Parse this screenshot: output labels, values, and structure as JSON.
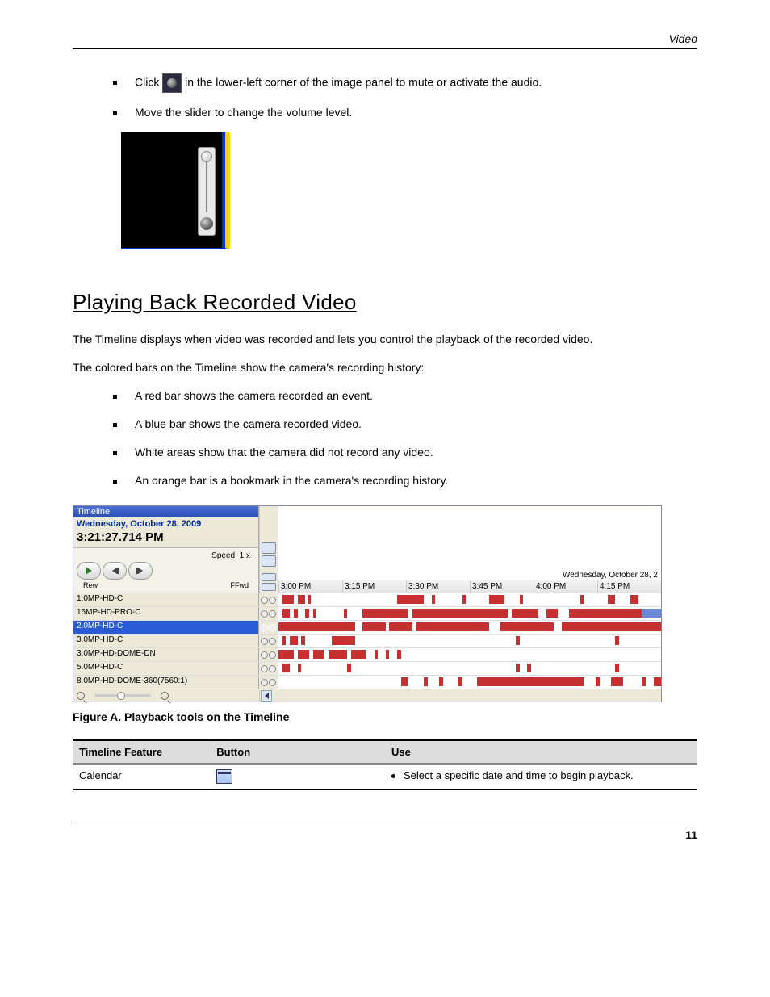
{
  "header": {
    "section": "Video"
  },
  "bullets_top": [
    {
      "text_before": "Click ",
      "icon": "volume-icon",
      "text_after": " in the lower-left corner of the image panel to mute or activate the audio."
    },
    {
      "text_before": "Move the slider to change the volume level.",
      "icon": null,
      "text_after": ""
    }
  ],
  "section_title": "Playing Back Recorded Video",
  "intro": "The Timeline displays when video was recorded and lets you control the playback of the recorded video.",
  "sub_intro": "The colored bars on the Timeline show the camera's recording history:",
  "legend": [
    "A red bar shows the camera recorded an event.",
    "A blue bar shows the camera recorded video.",
    "White areas show that the camera did not record any video.",
    "An orange bar is a bookmark in the camera's recording history."
  ],
  "timeline": {
    "title": "Timeline",
    "date": "Wednesday, October 28, 2009",
    "time": "3:21:27.714 PM",
    "speed": "Speed: 1 x",
    "rew": "Rew",
    "ffwd": "FFwd",
    "ruler_date": "Wednesday, October 28, 2",
    "ticks": [
      "3:00 PM",
      "3:15 PM",
      "3:30 PM",
      "3:45 PM",
      "4:00 PM",
      "4:15 PM"
    ],
    "rows": [
      {
        "label": "1.0MP-HD-C",
        "selected": false,
        "segs": [
          [
            1,
            4
          ],
          [
            5,
            7
          ],
          [
            7.5,
            8.5
          ],
          [
            31,
            38
          ],
          [
            40,
            41
          ],
          [
            48,
            49
          ],
          [
            55,
            59
          ],
          [
            63,
            64
          ],
          [
            79,
            80
          ],
          [
            86,
            88
          ],
          [
            92,
            94
          ]
        ]
      },
      {
        "label": "16MP-HD-PRO-C",
        "selected": false,
        "segs": [
          [
            1,
            3
          ],
          [
            4,
            5
          ],
          [
            7,
            8
          ],
          [
            9,
            10
          ],
          [
            17,
            18
          ],
          [
            22,
            30
          ],
          [
            30,
            34
          ],
          [
            35,
            55
          ],
          [
            55,
            60
          ],
          [
            61,
            68
          ],
          [
            70,
            73
          ],
          [
            76,
            95
          ],
          [
            95,
            100,
            "blue"
          ]
        ]
      },
      {
        "label": "2.0MP-HD-C",
        "selected": true,
        "segs": [
          [
            0,
            20
          ],
          [
            22,
            28
          ],
          [
            29,
            35
          ],
          [
            36,
            55
          ],
          [
            58,
            72
          ],
          [
            74,
            100
          ]
        ]
      },
      {
        "label": "3.0MP-HD-C",
        "selected": false,
        "segs": [
          [
            1,
            2
          ],
          [
            3,
            5
          ],
          [
            6,
            7
          ],
          [
            14,
            20
          ],
          [
            62,
            63
          ],
          [
            88,
            89
          ]
        ]
      },
      {
        "label": "3.0MP-HD-DOME-DN",
        "selected": false,
        "segs": [
          [
            0,
            4
          ],
          [
            5,
            8
          ],
          [
            9,
            12
          ],
          [
            13,
            18
          ],
          [
            19,
            23
          ],
          [
            25,
            26
          ],
          [
            28,
            29
          ],
          [
            31,
            32
          ]
        ]
      },
      {
        "label": "5.0MP-HD-C",
        "selected": false,
        "segs": [
          [
            1,
            3
          ],
          [
            5,
            6
          ],
          [
            18,
            19
          ],
          [
            62,
            63
          ],
          [
            65,
            66
          ],
          [
            88,
            89
          ]
        ]
      },
      {
        "label": "8.0MP-HD-DOME-360(7560:1)",
        "selected": false,
        "segs": [
          [
            32,
            34
          ],
          [
            38,
            39
          ],
          [
            42,
            43
          ],
          [
            47,
            48
          ],
          [
            52,
            70
          ],
          [
            70,
            80
          ],
          [
            83,
            84
          ],
          [
            87,
            90
          ],
          [
            95,
            96
          ],
          [
            98,
            100
          ]
        ]
      }
    ]
  },
  "figure_caption": "Figure A. Playback tools on the Timeline",
  "table": {
    "headers": [
      "Timeline Feature",
      "Button",
      "Use"
    ],
    "row": {
      "feature": "Calendar",
      "button_icon": "calendar-icon",
      "use": "Select a specific date and time to begin playback."
    }
  },
  "page_number": "11"
}
